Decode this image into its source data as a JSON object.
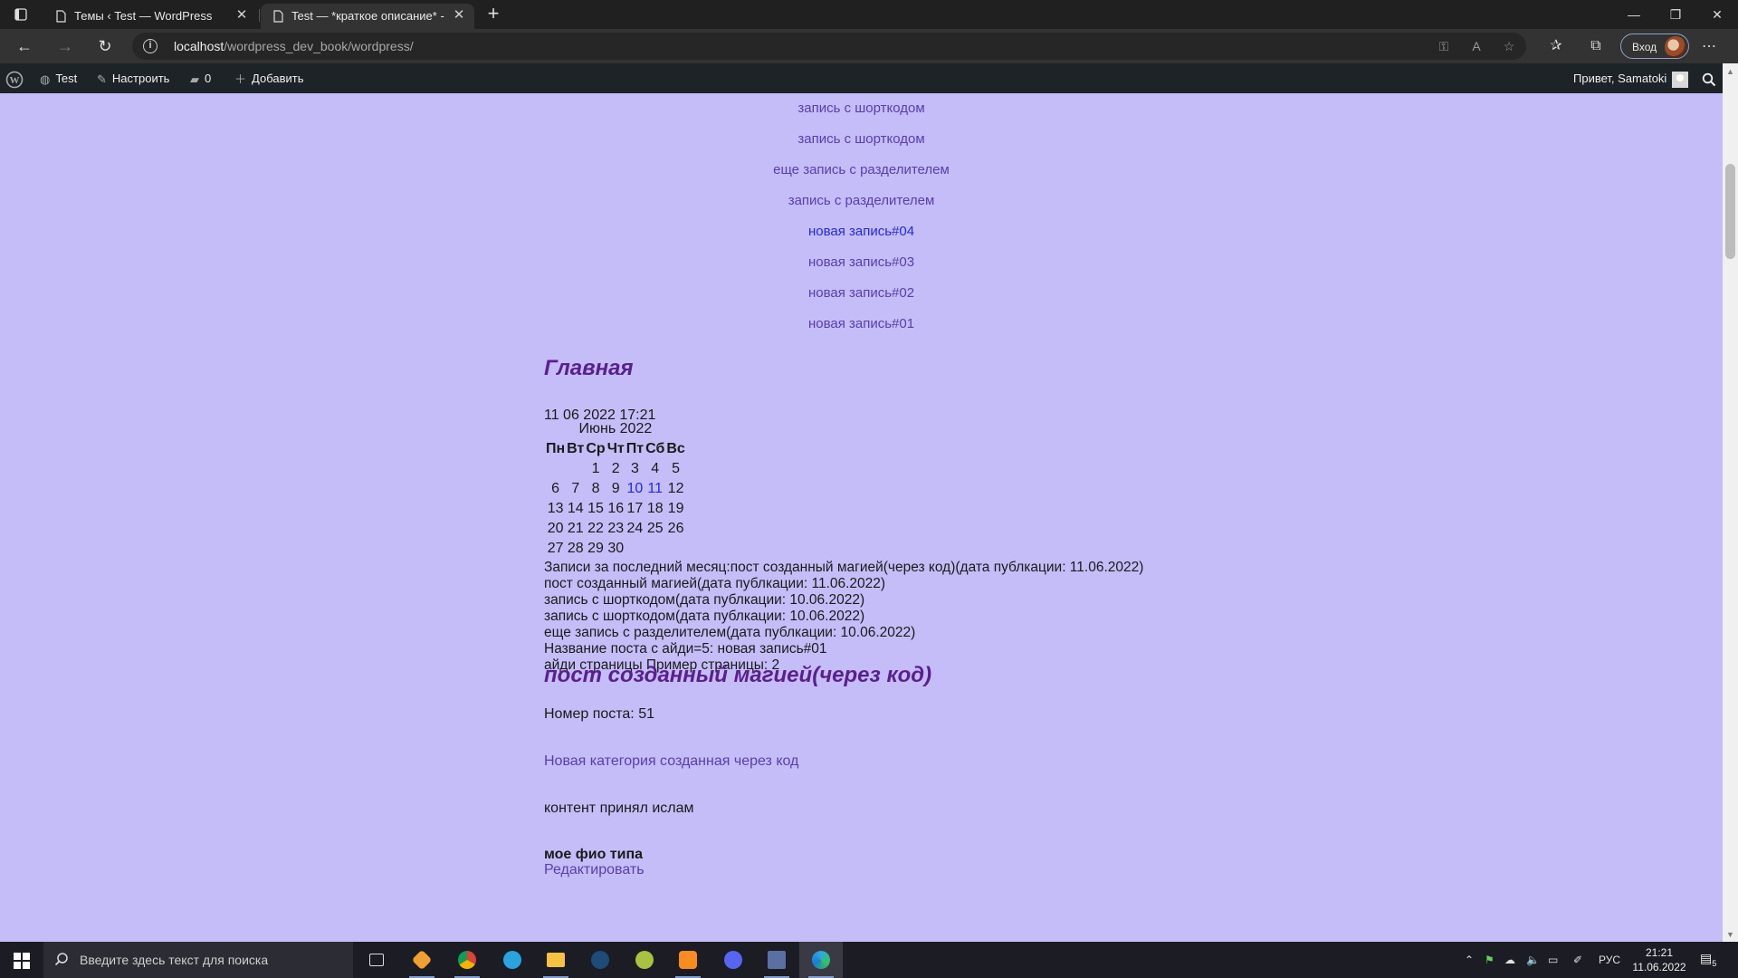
{
  "browser": {
    "tabs": [
      {
        "title": "Темы ‹ Test — WordPress",
        "active": false
      },
      {
        "title": "Test — *краткое описание* -",
        "active": true
      }
    ],
    "url_host": "localhost",
    "url_path": "/wordpress_dev_book/wordpress/",
    "signin_label": "Вход"
  },
  "adminbar": {
    "site_name": "Test",
    "customize": "Настроить",
    "comments_count": "0",
    "add_new": "Добавить",
    "greeting": "Привет, Samatoki"
  },
  "menu_links": [
    {
      "label": "запись с шорткодом",
      "state": "visited"
    },
    {
      "label": "запись с шорткодом",
      "state": "visited"
    },
    {
      "label": "еще запись с разделителем",
      "state": "visited"
    },
    {
      "label": "запись с разделителем",
      "state": "visited"
    },
    {
      "label": "новая запись#04",
      "state": "unvisited"
    },
    {
      "label": "новая запись#03",
      "state": "visited"
    },
    {
      "label": "новая запись#02",
      "state": "visited"
    },
    {
      "label": "новая запись#01",
      "state": "visited"
    }
  ],
  "main": {
    "heading": "Главная",
    "datetime": "11 06 2022 17:21",
    "calendar": {
      "caption": "Июнь 2022",
      "weekdays": [
        "Пн",
        "Вт",
        "Ср",
        "Чт",
        "Пт",
        "Сб",
        "Вс"
      ],
      "weeks": [
        [
          "",
          "",
          "1",
          "2",
          "3",
          "4",
          "5"
        ],
        [
          "6",
          "7",
          "8",
          "9",
          "10",
          "11",
          "12"
        ],
        [
          "13",
          "14",
          "15",
          "16",
          "17",
          "18",
          "19"
        ],
        [
          "20",
          "21",
          "22",
          "23",
          "24",
          "25",
          "26"
        ],
        [
          "27",
          "28",
          "29",
          "30",
          "",
          "",
          ""
        ]
      ],
      "linked_days": [
        "10",
        "11"
      ]
    },
    "month_posts": [
      "Записи за последний месяц:пост созданный магией(через код)(дата публкации: 11.06.2022)",
      "пост созданный магией(дата публкации: 11.06.2022)",
      "запись с шорткодом(дата публкации: 10.06.2022)",
      "запись с шорткодом(дата публкации: 10.06.2022)",
      "еще запись с разделителем(дата публкации: 10.06.2022)",
      "Название поста с айди=5: новая запись#01",
      "айди страницы Пример страницы: 2"
    ]
  },
  "post": {
    "title": "пост созданный магией(через код)",
    "number": "Номер поста: 51",
    "category": "Новая категория созданная через код",
    "content": "контент принял ислам",
    "fio": "мое фио типа",
    "edit": "Редактировать"
  },
  "taskbar": {
    "search_placeholder": "Введите здесь текст для поиска",
    "language": "РУС",
    "time": "21:21",
    "date": "11.06.2022",
    "notifications": "5"
  }
}
